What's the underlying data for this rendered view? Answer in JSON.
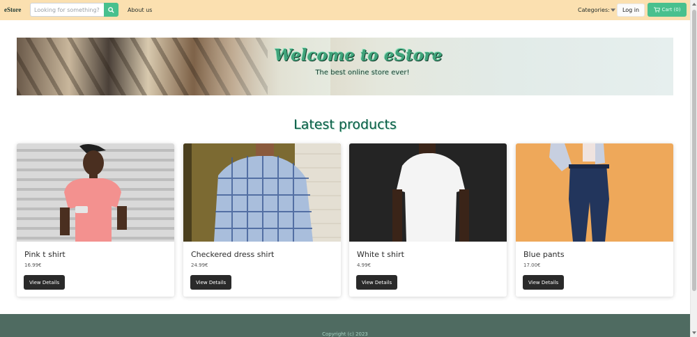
{
  "navbar": {
    "brand": "eStore",
    "search_placeholder": "Looking for something?",
    "about_label": "About us",
    "categories_label": "Categories:",
    "login_label": "Log in",
    "cart_label": "Cart (0)",
    "colors": {
      "background": "#fbe0b0",
      "accent": "#48c08e"
    }
  },
  "hero": {
    "title": "Welcome to eStore",
    "subtitle": "The best online store ever!"
  },
  "latest": {
    "title": "Latest products"
  },
  "products": [
    {
      "name": "Pink t shirt",
      "price": "16.99€",
      "button": "View Details"
    },
    {
      "name": "Checkered dress shirt",
      "price": "24.99€",
      "button": "View Details"
    },
    {
      "name": "White t shirt",
      "price": "4.99€",
      "button": "View Details"
    },
    {
      "name": "Blue pants",
      "price": "17.00€",
      "button": "View Details"
    }
  ],
  "footer": {
    "text": "Copyright (c) 2023"
  },
  "icons": {
    "search": "search-icon",
    "categories": "caret-down-icon",
    "cart": "cart-icon"
  }
}
